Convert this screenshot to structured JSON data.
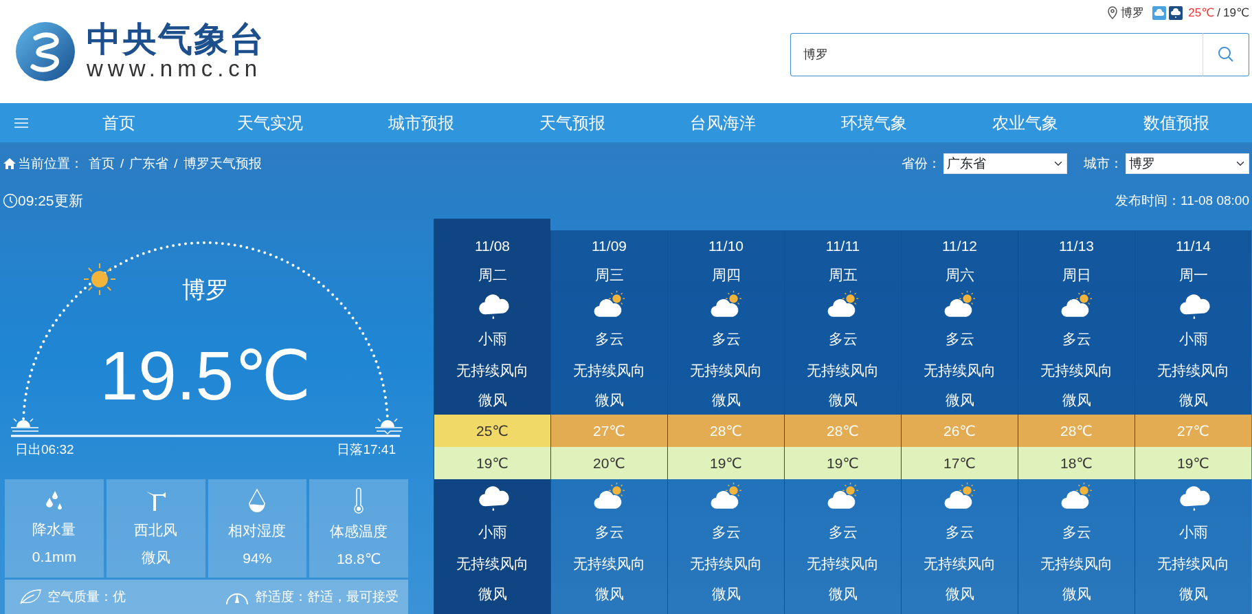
{
  "header": {
    "logo": {
      "title": "中央气象台",
      "url": "www.nmc.cn"
    },
    "location": {
      "city": "博罗",
      "high": "25℃",
      "separator": "/",
      "low": "19℃"
    },
    "search": {
      "value": "博罗"
    }
  },
  "nav": {
    "items": [
      {
        "label": "首页"
      },
      {
        "label": "天气实况"
      },
      {
        "label": "城市预报"
      },
      {
        "label": "天气预报"
      },
      {
        "label": "台风海洋"
      },
      {
        "label": "环境气象"
      },
      {
        "label": "农业气象"
      },
      {
        "label": "数值预报"
      }
    ]
  },
  "breadcrumb": {
    "label": "当前位置：",
    "separator": "/",
    "items": [
      "首页",
      "广东省",
      "博罗天气预报"
    ]
  },
  "filters": [
    {
      "label": "省份：",
      "value": "广东省"
    },
    {
      "label": "城市：",
      "value": "博罗"
    }
  ],
  "update_time": "09:25更新",
  "publish_time": "发布时间：11-08 08:00",
  "current": {
    "city": "博罗",
    "temperature": "19.5℃",
    "sunrise": "日出06:32",
    "sunset": "日落17:41",
    "stats": [
      {
        "kind": "precipitation",
        "label": "降水量",
        "value": "0.1mm"
      },
      {
        "kind": "wind",
        "label": "西北风",
        "value": "微风"
      },
      {
        "kind": "humidity",
        "label": "相对湿度",
        "value": "94%"
      },
      {
        "kind": "feels_like",
        "label": "体感温度",
        "value": "18.8℃"
      }
    ],
    "air_quality": "空气质量：优",
    "comfort": "舒适度：舒适，最可接受"
  },
  "forecast": [
    {
      "date": "11/08",
      "weekday": "周二",
      "selected": true,
      "day": {
        "kind": "rain",
        "weather": "小雨",
        "wind_direction": "无持续风向",
        "wind": "微风"
      },
      "high": {
        "text": "25℃",
        "color": "#f0d966"
      },
      "low": "19℃",
      "night": {
        "kind": "rain",
        "weather": "小雨",
        "wind_direction": "无持续风向",
        "wind": "微风"
      }
    },
    {
      "date": "11/09",
      "weekday": "周三",
      "selected": false,
      "day": {
        "kind": "partly_cloudy",
        "weather": "多云",
        "wind_direction": "无持续风向",
        "wind": "微风"
      },
      "high": {
        "text": "27℃",
        "color": "#e3ab52"
      },
      "low": "20℃",
      "night": {
        "kind": "partly_cloudy",
        "weather": "多云",
        "wind_direction": "无持续风向",
        "wind": "微风"
      }
    },
    {
      "date": "11/10",
      "weekday": "周四",
      "selected": false,
      "day": {
        "kind": "partly_cloudy",
        "weather": "多云",
        "wind_direction": "无持续风向",
        "wind": "微风"
      },
      "high": {
        "text": "28℃",
        "color": "#e3ab52"
      },
      "low": "19℃",
      "night": {
        "kind": "partly_cloudy",
        "weather": "多云",
        "wind_direction": "无持续风向",
        "wind": "微风"
      }
    },
    {
      "date": "11/11",
      "weekday": "周五",
      "selected": false,
      "day": {
        "kind": "partly_cloudy",
        "weather": "多云",
        "wind_direction": "无持续风向",
        "wind": "微风"
      },
      "high": {
        "text": "28℃",
        "color": "#e3ab52"
      },
      "low": "19℃",
      "night": {
        "kind": "partly_cloudy",
        "weather": "多云",
        "wind_direction": "无持续风向",
        "wind": "微风"
      }
    },
    {
      "date": "11/12",
      "weekday": "周六",
      "selected": false,
      "day": {
        "kind": "partly_cloudy",
        "weather": "多云",
        "wind_direction": "无持续风向",
        "wind": "微风"
      },
      "high": {
        "text": "26℃",
        "color": "#e3ab52"
      },
      "low": "17℃",
      "night": {
        "kind": "partly_cloudy",
        "weather": "多云",
        "wind_direction": "无持续风向",
        "wind": "微风"
      }
    },
    {
      "date": "11/13",
      "weekday": "周日",
      "selected": false,
      "day": {
        "kind": "partly_cloudy",
        "weather": "多云",
        "wind_direction": "无持续风向",
        "wind": "微风"
      },
      "high": {
        "text": "28℃",
        "color": "#e3ab52"
      },
      "low": "18℃",
      "night": {
        "kind": "partly_cloudy",
        "weather": "多云",
        "wind_direction": "无持续风向",
        "wind": "微风"
      }
    },
    {
      "date": "11/14",
      "weekday": "周一",
      "selected": false,
      "day": {
        "kind": "rain",
        "weather": "小雨",
        "wind_direction": "无持续风向",
        "wind": "微风"
      },
      "high": {
        "text": "27℃",
        "color": "#e3ab52"
      },
      "low": "19℃",
      "night": {
        "kind": "rain",
        "weather": "小雨",
        "wind_direction": "无持续风向",
        "wind": "微风"
      }
    }
  ]
}
